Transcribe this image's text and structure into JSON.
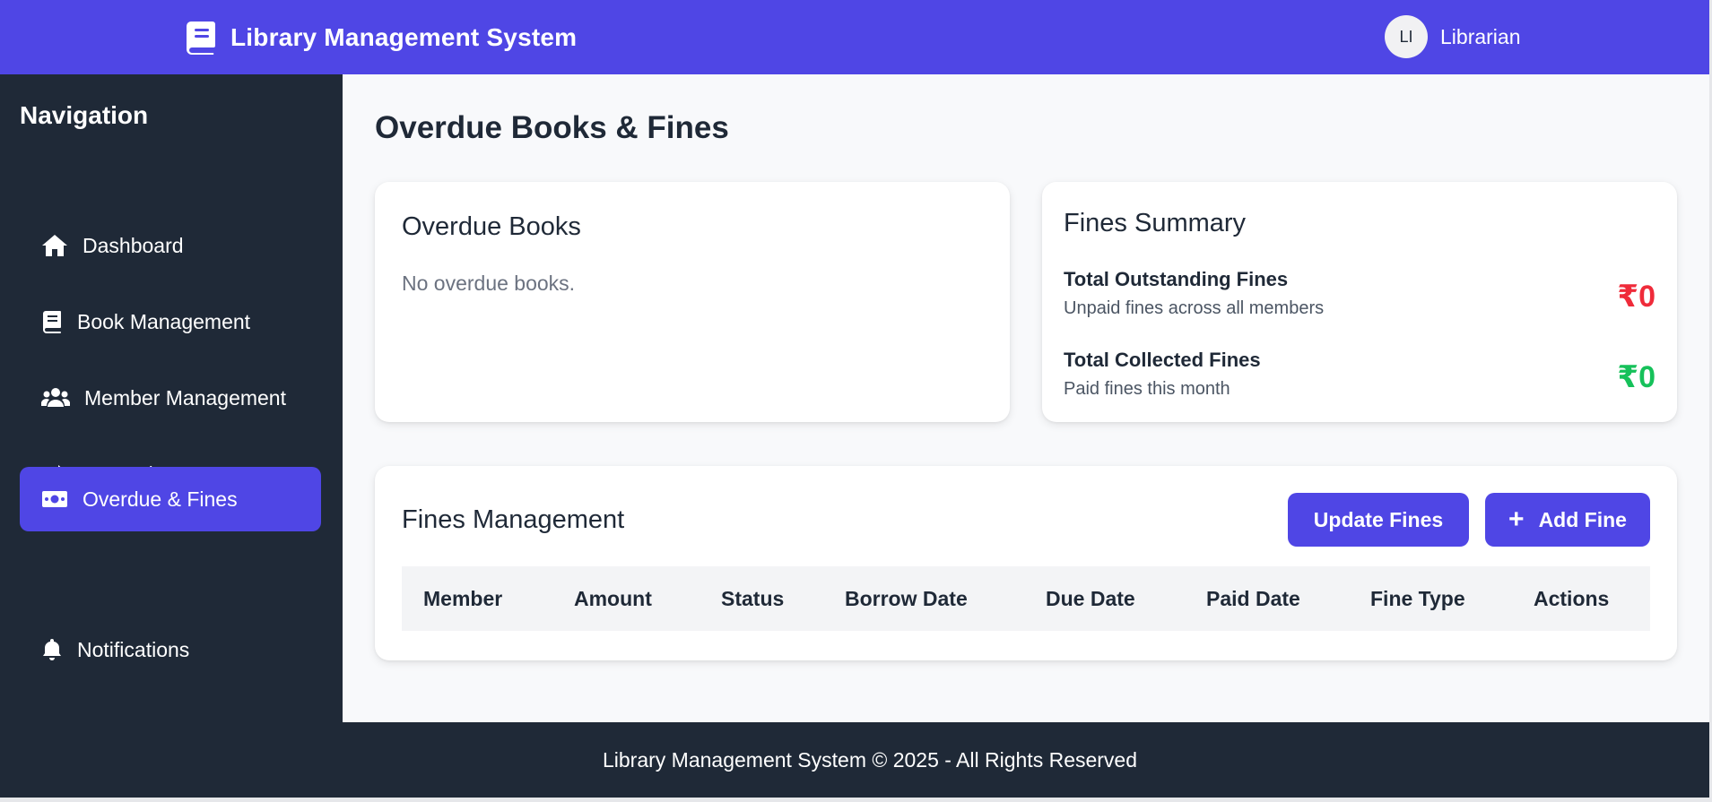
{
  "header": {
    "title": "Library Management System",
    "brand_icon": "book-icon",
    "user": {
      "initials": "LI",
      "name": "Librarian"
    }
  },
  "sidebar": {
    "title": "Navigation",
    "items": [
      {
        "label": "Dashboard",
        "icon": "home-icon",
        "active": false
      },
      {
        "label": "Book Management",
        "icon": "book-icon",
        "active": false
      },
      {
        "label": "Member Management",
        "icon": "users-icon",
        "active": false
      },
      {
        "label": "Borrow/Return",
        "icon": "exchange-icon",
        "active": false
      },
      {
        "label": "Overdue & Fines",
        "icon": "money-bill-icon",
        "active": true
      },
      {
        "label": "Notifications",
        "icon": "bell-icon",
        "active": false
      }
    ]
  },
  "main": {
    "page_title": "Overdue Books & Fines",
    "overdue": {
      "title": "Overdue Books",
      "empty_message": "No overdue books."
    },
    "fines_summary": {
      "title": "Fines Summary",
      "outstanding": {
        "label": "Total Outstanding Fines",
        "sub": "Unpaid fines across all members",
        "value": "₹0",
        "color": "#ef2b3a"
      },
      "collected": {
        "label": "Total Collected Fines",
        "sub": "Paid fines this month",
        "value": "₹0",
        "color": "#16c15a"
      }
    },
    "fines_management": {
      "title": "Fines Management",
      "update_label": "Update Fines",
      "add_label": "Add Fine",
      "columns": [
        "Member",
        "Amount",
        "Status",
        "Borrow Date",
        "Due Date",
        "Paid Date",
        "Fine Type",
        "Actions"
      ]
    }
  },
  "footer": {
    "text": "Library Management System © 2025 - All Rights Reserved"
  },
  "colors": {
    "primary": "#4f46e5",
    "sidebar": "#1f2937"
  }
}
